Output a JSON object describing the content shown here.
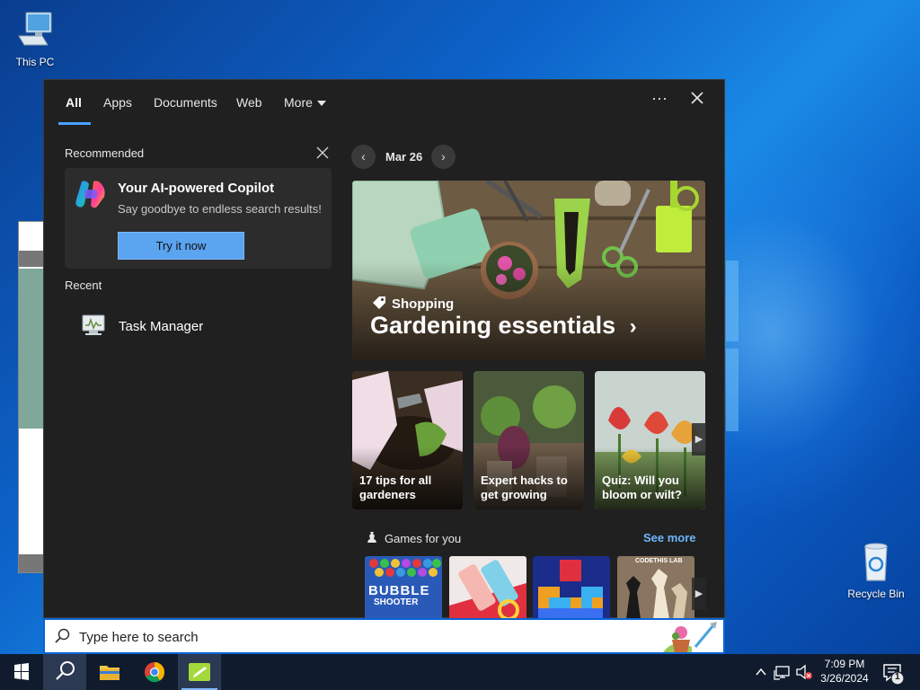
{
  "desktop": {
    "icons": [
      {
        "label": "This PC"
      },
      {
        "label": "Recycle Bin"
      }
    ]
  },
  "search_panel": {
    "tabs": [
      {
        "label": "All",
        "active": true
      },
      {
        "label": "Apps"
      },
      {
        "label": "Documents"
      },
      {
        "label": "Web"
      },
      {
        "label": "More"
      }
    ],
    "more_options_icon": "ellipsis-icon",
    "close_icon": "close-icon",
    "recommended": {
      "title": "Recommended",
      "card": {
        "title": "Your AI-powered Copilot",
        "subtitle": "Say goodbye to endless search results!",
        "button": "Try it now"
      }
    },
    "recent": {
      "title": "Recent",
      "items": [
        {
          "label": "Task Manager",
          "icon": "task-manager-icon"
        }
      ]
    },
    "feed": {
      "date": "Mar 26",
      "hero": {
        "kicker": "Shopping",
        "title": "Gardening essentials"
      },
      "cards": [
        {
          "caption": "17 tips for all gardeners"
        },
        {
          "caption": "Expert hacks to get growing"
        },
        {
          "caption": "Quiz: Will you bloom or wilt?"
        }
      ],
      "games": {
        "title": "Games for you",
        "see_more": "See more",
        "tiles": [
          {
            "name": "bubble-shooter",
            "line1": "BUBBLE",
            "line2": "SHOOTER"
          },
          {
            "name": "game-2"
          },
          {
            "name": "block-puzzle"
          },
          {
            "name": "chess",
            "label": "CODETHIS LAB"
          }
        ]
      }
    }
  },
  "searchbox": {
    "placeholder": "Type here to search"
  },
  "taskbar": {
    "apps": [
      "start-button",
      "search",
      "file-explorer",
      "chrome",
      "notepad-app"
    ],
    "clock": {
      "time": "7:09 PM",
      "date": "3/26/2024"
    },
    "notification_count": "1"
  },
  "colors": {
    "accent": "#4aa3ff",
    "panel_bg": "#202020",
    "see_more": "#6cb6ff",
    "taskbar": "#101c2e"
  }
}
